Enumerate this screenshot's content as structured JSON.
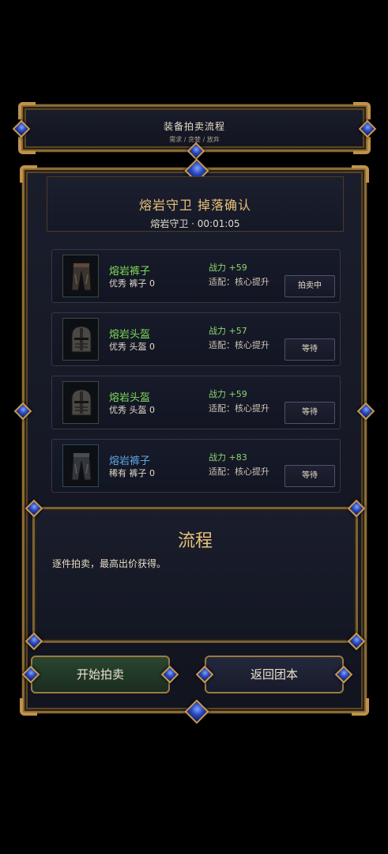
{
  "header": {
    "title": "装备拍卖流程",
    "subtitle": "需求 / 贪婪 / 放弃"
  },
  "panel": {
    "title": "熔岩守卫 掉落确认",
    "subtitle": "熔岩守卫 · 00:01:05"
  },
  "items": [
    {
      "name": "熔岩裤子",
      "meta": "优秀 裤子 0",
      "power": "战力 +59",
      "fit": "适配：核心提升",
      "state": "拍卖中",
      "rarity_color": "#7fdc58",
      "icon": "pants-icon"
    },
    {
      "name": "熔岩头盔",
      "meta": "优秀 头盔 0",
      "power": "战力 +57",
      "fit": "适配：核心提升",
      "state": "等待",
      "rarity_color": "#7fdc58",
      "icon": "helmet-icon"
    },
    {
      "name": "熔岩头盔",
      "meta": "优秀 头盔 0",
      "power": "战力 +59",
      "fit": "适配：核心提升",
      "state": "等待",
      "rarity_color": "#7fdc58",
      "icon": "helmet-icon"
    },
    {
      "name": "熔岩裤子",
      "meta": "稀有 裤子 0",
      "power": "战力 +83",
      "fit": "适配：核心提升",
      "state": "等待",
      "rarity_color": "#5ea7e8",
      "icon": "pants-icon"
    }
  ],
  "flow": {
    "title": "流程",
    "desc": "逐件拍卖，最高出价获得。"
  },
  "actions": {
    "start_label": "开始拍卖",
    "back_label": "返回团本"
  }
}
